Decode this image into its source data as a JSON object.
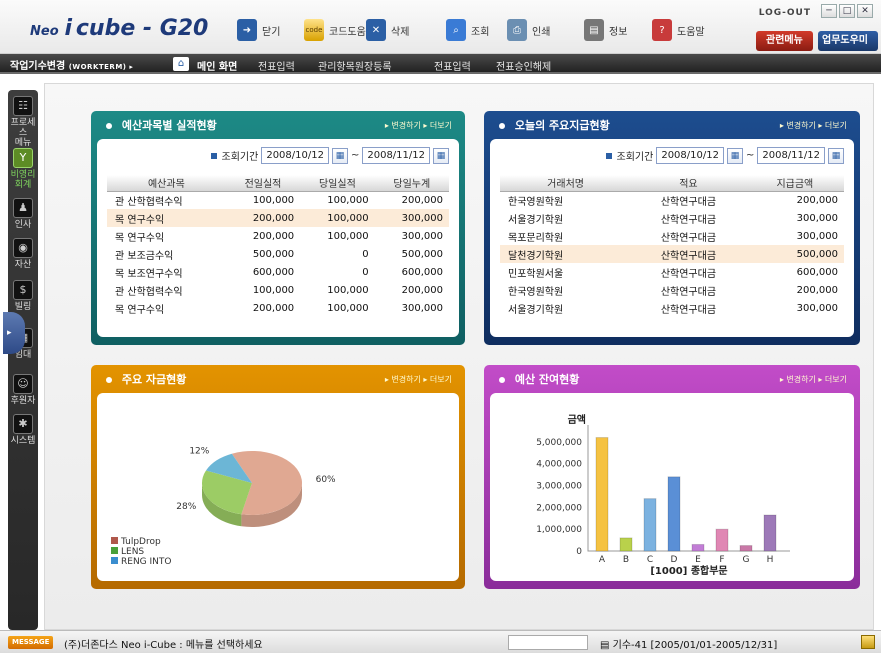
{
  "app": {
    "logo_prefix": "Neo",
    "logo_i": "i",
    "logo_main": "cube - G20"
  },
  "toolbar": [
    {
      "name": "close-button",
      "label": "닫기",
      "icon": "arrow-right-icon",
      "color": "#2b5fa5",
      "glyph": "➜"
    },
    {
      "name": "code-help-button",
      "label": "코드도움",
      "icon": "code-icon",
      "color": "#d8a100",
      "glyph": "code"
    },
    {
      "name": "delete-button",
      "label": "삭제",
      "icon": "trash-icon",
      "color": "#2b5fa5",
      "glyph": "✕"
    },
    {
      "name": "search-button",
      "label": "조회",
      "icon": "search-icon",
      "color": "#3a7bd5",
      "glyph": "⌕"
    },
    {
      "name": "print-button",
      "label": "인쇄",
      "icon": "printer-icon",
      "color": "#6b8fb2",
      "glyph": "⎙"
    },
    {
      "name": "info-button",
      "label": "정보",
      "icon": "info-icon",
      "color": "#777777",
      "glyph": "▤"
    },
    {
      "name": "help-button",
      "label": "도움말",
      "icon": "help-icon",
      "color": "#c83b3b",
      "glyph": "?"
    }
  ],
  "header_right": {
    "logout": "LOG-OUT",
    "related_menu": "관련메뉴",
    "work_helper": "업무도우미",
    "win_min": "─",
    "win_max": "□",
    "win_close": "✕"
  },
  "menubar": {
    "workterm_label": "작업기수변경",
    "workterm_sub": "(WORKTERM) ▸",
    "home_glyph": "⌂",
    "items": [
      "메인 화면",
      "전표입력",
      "관리항목원장등록",
      "전표입력",
      "전표승인해제"
    ]
  },
  "sidebar": [
    {
      "label": "프로세스\n메뉴",
      "glyph": "☷",
      "icon": "process-menu-icon"
    },
    {
      "label": "비영리\n회계",
      "glyph": "Y",
      "icon": "nonprofit-accounting-icon",
      "active": true
    },
    {
      "label": "인사",
      "glyph": "♟",
      "icon": "hr-icon"
    },
    {
      "label": "자산",
      "glyph": "◉",
      "icon": "asset-icon"
    },
    {
      "label": "빌링",
      "glyph": "$",
      "icon": "billing-icon"
    },
    {
      "label": "임대",
      "glyph": "▦",
      "icon": "lease-icon"
    },
    {
      "label": "후원자",
      "glyph": "☺",
      "icon": "sponsor-icon"
    },
    {
      "label": "시스템",
      "glyph": "✱",
      "icon": "system-icon"
    }
  ],
  "panels": {
    "budget": {
      "title": "예산과목별 실적현황",
      "links": "▸ 변경하기  ▸ 더보기",
      "period_label": "조회기간",
      "date_from": "2008/10/12",
      "date_to": "2008/11/12",
      "tilde": "~",
      "columns": [
        "예산과목",
        "전일실적",
        "당일실적",
        "당일누계"
      ],
      "rows": [
        [
          "관 산학협력수익",
          "100,000",
          "100,000",
          "200,000"
        ],
        [
          "목 연구수익",
          "200,000",
          "100,000",
          "300,000"
        ],
        [
          "목 연구수익",
          "200,000",
          "100,000",
          "300,000"
        ],
        [
          "관 보조금수익",
          "500,000",
          "0",
          "500,000"
        ],
        [
          "목 보조연구수익",
          "600,000",
          "0",
          "600,000"
        ],
        [
          "관 산학협력수익",
          "100,000",
          "100,000",
          "200,000"
        ],
        [
          "목 연구수익",
          "200,000",
          "100,000",
          "300,000"
        ]
      ],
      "highlight_row": 1
    },
    "payments": {
      "title": "오늘의  주요지급현황",
      "links": "▸ 변경하기  ▸ 더보기",
      "period_label": "조회기간",
      "date_from": "2008/10/12",
      "date_to": "2008/11/12",
      "tilde": "~",
      "columns": [
        "거래처명",
        "적요",
        "지급금액"
      ],
      "rows": [
        [
          "한국영원학원",
          "산학연구대금",
          "200,000"
        ],
        [
          "서울경기학원",
          "산학연구대금",
          "300,000"
        ],
        [
          "목포문리학원",
          "산학연구대금",
          "300,000"
        ],
        [
          "달천경기학원",
          "산학연구대금",
          "500,000"
        ],
        [
          "민포학원서울",
          "산학연구대금",
          "600,000"
        ],
        [
          "한국영원학원",
          "산학연구대금",
          "200,000"
        ],
        [
          "서울경기학원",
          "산학연구대금",
          "300,000"
        ]
      ],
      "highlight_row": 3
    },
    "funds": {
      "title": "주요 자금현황",
      "links": "▸ 변경하기  ▸ 더보기"
    },
    "budget_balance": {
      "title": "예산 잔여현황",
      "links": "▸ 변경하기  ▸ 더보기"
    }
  },
  "chart_data": [
    {
      "type": "pie",
      "title": "",
      "series": [
        {
          "name": "TulpDrop",
          "value": 60,
          "color": "#e0a892",
          "label": "60%"
        },
        {
          "name": "LENS",
          "value": 28,
          "color": "#9ccc65",
          "label": "28%"
        },
        {
          "name": "RENG INTO",
          "value": 12,
          "color": "#6cb6d6",
          "label": "12%"
        }
      ],
      "legend_position": "bottom-left"
    },
    {
      "type": "bar",
      "ylabel": "금액",
      "xlabel": "[1000] 종합부문",
      "categories": [
        "A",
        "B",
        "C",
        "D",
        "E",
        "F",
        "G",
        "H"
      ],
      "values": [
        5200000,
        600000,
        2400000,
        3400000,
        300000,
        1000000,
        250000,
        1650000
      ],
      "colors": [
        "#f5c242",
        "#b9d14b",
        "#7cb2e0",
        "#5a8fd6",
        "#c27dd6",
        "#e087b4",
        "#c978a7",
        "#9d79b8"
      ],
      "yticks": [
        "5,000,000",
        "4,000,000",
        "3,000,000",
        "2,000,000",
        "1,000,000",
        "0"
      ],
      "ylim": [
        0,
        5500000
      ],
      "grid": false
    }
  ],
  "status": {
    "badge": "MESSAGE",
    "text": "(주)더존다스 Neo i-Cube : 메뉴를 선택하세요",
    "period": "기수-41  [2005/01/01-2005/12/31]",
    "period_icon": "▤"
  }
}
